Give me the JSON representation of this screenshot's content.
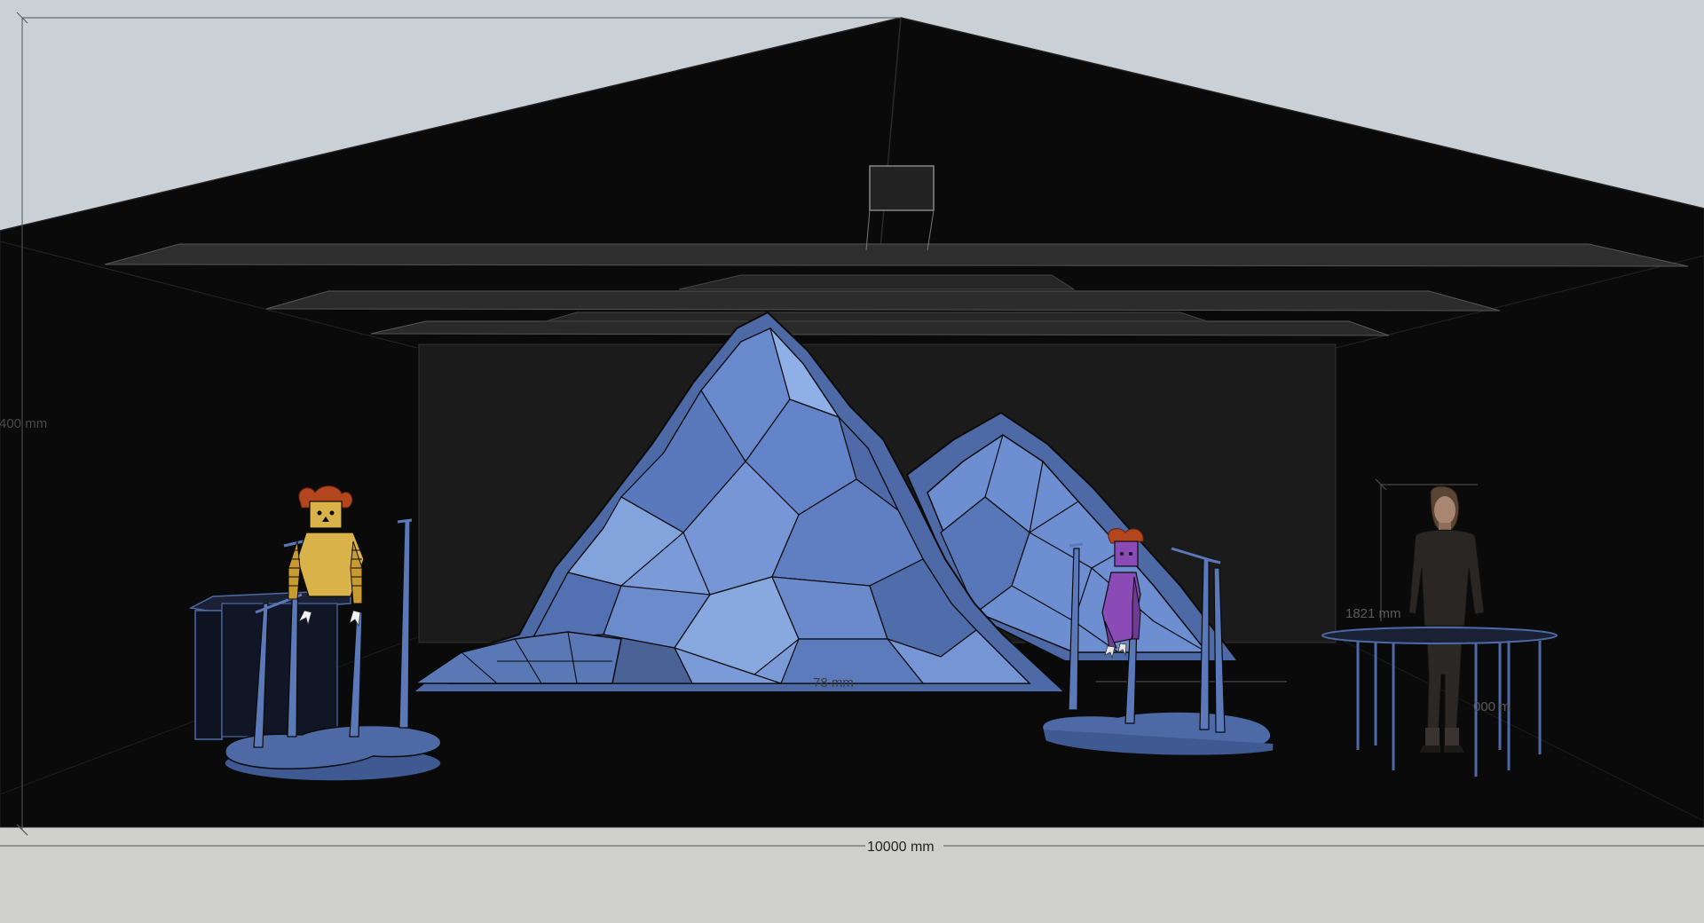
{
  "scene": {
    "colors": {
      "sky": "#c9d0d6",
      "ground": "#cfcfcb",
      "hall": "#090909",
      "backdrop": "#1b1b1b",
      "mountain_light": "#7f9fd6",
      "mountain_mid": "#6a88c8",
      "mountain_dark": "#4a6296",
      "scenery_blue": "#4d6aa6",
      "puppet_yellow": "#d9b24a",
      "puppet_purple": "#8a4bb6",
      "puppet_hair": "#b3451f",
      "dimension_line": "#4a4a4a"
    },
    "dimensions": {
      "total_width": "10000 mm",
      "total_height": "400 mm",
      "mountain_depth": "78  mm",
      "figure_height": "1821 mm",
      "table_height": "000 m"
    },
    "icons": [
      "hall-roof",
      "mountain-flat",
      "marionette-yellow",
      "marionette-purple",
      "scale-figure",
      "tech-table",
      "dimension-line"
    ]
  }
}
